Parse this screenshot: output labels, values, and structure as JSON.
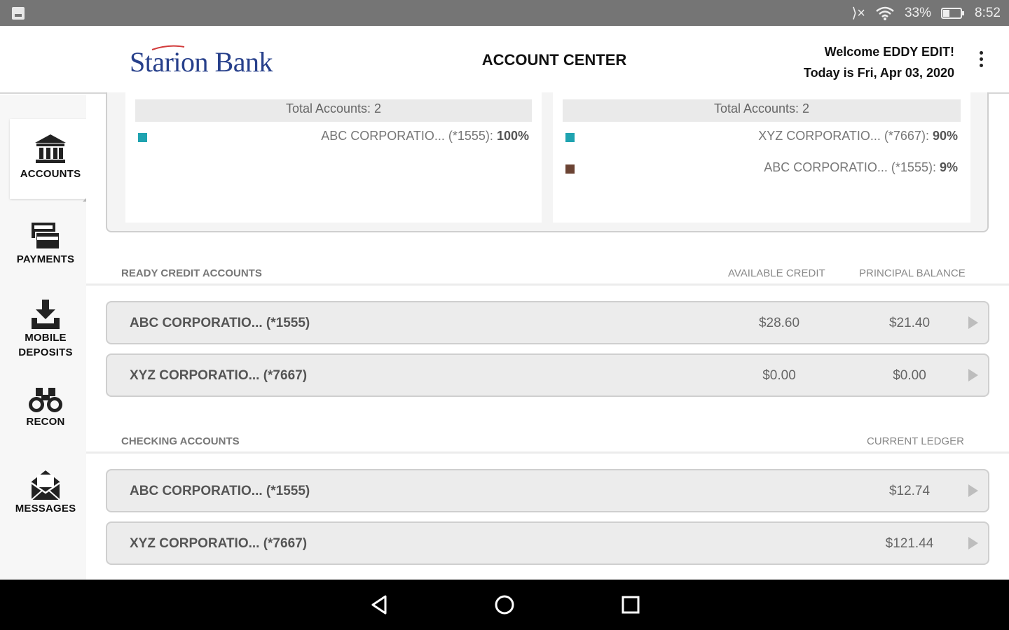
{
  "status_bar": {
    "battery": "33%",
    "time": "8:52"
  },
  "header": {
    "logo": "Starion Bank",
    "title": "ACCOUNT CENTER",
    "welcome": "Welcome EDDY EDIT!",
    "date": "Today is Fri, Apr 03, 2020"
  },
  "sidebar": {
    "items": [
      {
        "label": "ACCOUNTS",
        "icon": "bank-icon"
      },
      {
        "label": "PAYMENTS",
        "icon": "card-icon"
      },
      {
        "label": "MOBILE",
        "label2": "DEPOSITS",
        "icon": "download-tray-icon"
      },
      {
        "label": "RECON",
        "icon": "binoculars-icon"
      },
      {
        "label": "MESSAGES",
        "icon": "envelope-icon"
      }
    ]
  },
  "charts": [
    {
      "total": "Total Accounts: 2",
      "legend": [
        {
          "name": "ABC CORPORATIO... (*1555):",
          "pct": "100%",
          "color": "#1fa3b0"
        }
      ]
    },
    {
      "total": "Total Accounts: 2",
      "legend": [
        {
          "name": "XYZ CORPORATIO... (*7667):",
          "pct": "90%",
          "color": "#1fa3b0"
        },
        {
          "name": "ABC CORPORATIO... (*1555):",
          "pct": "9%",
          "color": "#6b4333"
        }
      ]
    }
  ],
  "ready_credit": {
    "label": "READY CREDIT ACCOUNTS",
    "col1": "AVAILABLE CREDIT",
    "col2": "PRINCIPAL BALANCE",
    "rows": [
      {
        "name": "ABC CORPORATIO... (*1555)",
        "available": "$28.60",
        "principal": "$21.40"
      },
      {
        "name": "XYZ CORPORATIO... (*7667)",
        "available": "$0.00",
        "principal": "$0.00"
      }
    ]
  },
  "checking": {
    "label": "CHECKING ACCOUNTS",
    "col1": "CURRENT LEDGER",
    "rows": [
      {
        "name": "ABC CORPORATIO... (*1555)",
        "ledger": "$12.74"
      },
      {
        "name": "XYZ CORPORATIO... (*7667)",
        "ledger": "$121.44"
      }
    ]
  }
}
